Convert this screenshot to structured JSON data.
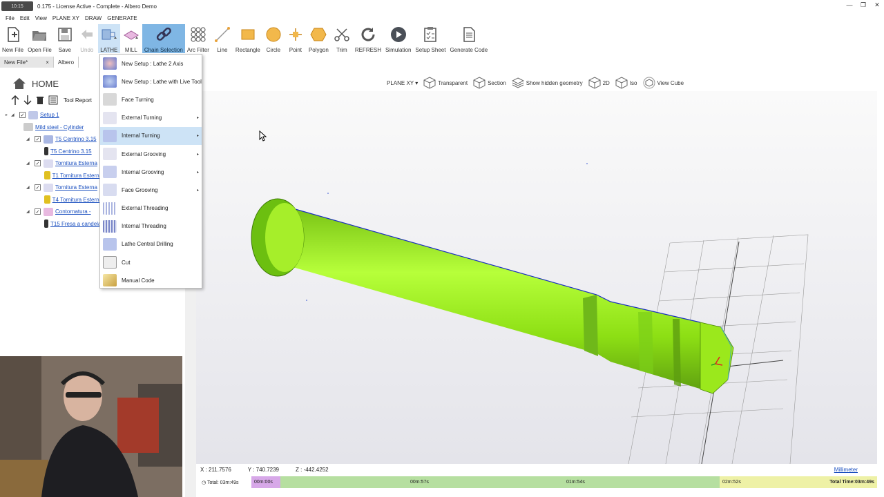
{
  "window": {
    "title": "0.175 - License Active - Complete - Albero Demo",
    "sys_label": "10:15",
    "min": "—",
    "restore": "❐",
    "close": "✕"
  },
  "menu": [
    "File",
    "Edit",
    "View",
    "PLANE XY",
    "DRAW",
    "GENERATE"
  ],
  "ribbon": {
    "new_file": "New File",
    "open_file": "Open File",
    "save": "Save",
    "undo": "Undo",
    "lathe": "LATHE",
    "mill": "MILL",
    "chain_selection": "Chain Selection",
    "arc_filter": "Arc Filter",
    "line": "Line",
    "rectangle": "Rectangle",
    "circle": "Circle",
    "point": "Point",
    "polygon": "Polygon",
    "trim": "Trim",
    "refresh": "REFRESH",
    "simulation": "Simulation",
    "setup_sheet": "Setup Sheet",
    "generate_code": "Generate Code"
  },
  "tabs": [
    {
      "label": "New File*",
      "close": "×"
    },
    {
      "label": "Albero"
    }
  ],
  "left": {
    "home": "HOME",
    "tool_report": "Tool Report",
    "tree": [
      {
        "label": "Setup 1"
      },
      {
        "label": "Mild steel - Cylinder"
      },
      {
        "label": "T5 Centrino 3.15"
      },
      {
        "label": "T5 Centrino 3.15"
      },
      {
        "label": "Tornitura Esterna"
      },
      {
        "label": "T1 Tornitura Esterna"
      },
      {
        "label": "Tornitura Esterna"
      },
      {
        "label": "T4 Tornitura Esterna"
      },
      {
        "label": "Contornatura -"
      },
      {
        "label": "T15 Fresa a candela"
      }
    ]
  },
  "dropdown": [
    {
      "label": "New Setup : Lathe 2 Axis",
      "sub": false
    },
    {
      "label": "New Setup : Lathe with Live Tool",
      "sub": false
    },
    {
      "label": "Face Turning",
      "sub": false
    },
    {
      "label": "External Turning",
      "sub": true
    },
    {
      "label": "Internal Turning",
      "sub": true
    },
    {
      "label": "External Grooving",
      "sub": true
    },
    {
      "label": "Internal Grooving",
      "sub": true
    },
    {
      "label": "Face Grooving",
      "sub": true
    },
    {
      "label": "External Threading",
      "sub": false
    },
    {
      "label": "Internal Threading",
      "sub": false
    },
    {
      "label": "Lathe Central Drilling",
      "sub": false
    },
    {
      "label": "Cut",
      "sub": false
    },
    {
      "label": "Manual Code",
      "sub": false
    }
  ],
  "submenu_arrow": "▸",
  "viewtoolbar": {
    "plane": "PLANE XY ▾",
    "transparent": "Transparent",
    "section": "Section",
    "hidden": "Show hidden geometry",
    "d2": "2D",
    "iso": "Iso",
    "cube": "View Cube"
  },
  "coords": {
    "x": "X : 211.7576",
    "y": "Y : 740.7239",
    "z": "Z : -442.4252",
    "unit": "Millimeter"
  },
  "timeline": {
    "total_left": "Total: 03m:49s",
    "t0": "00m:00s",
    "t1": "00m:57s",
    "t2": "01m:54s",
    "t3": "02m:52s",
    "total_right": "Total Time:03m:49s"
  },
  "colors": {
    "part": "#9bee1c",
    "accent": "#1a4fbf",
    "chain": "#7fb6e4",
    "highlight": "#cde3f6",
    "timeline_pink": "#d7a8e8",
    "timeline_green": "#b6dfa0",
    "timeline_yellow": "#eef1a6"
  }
}
